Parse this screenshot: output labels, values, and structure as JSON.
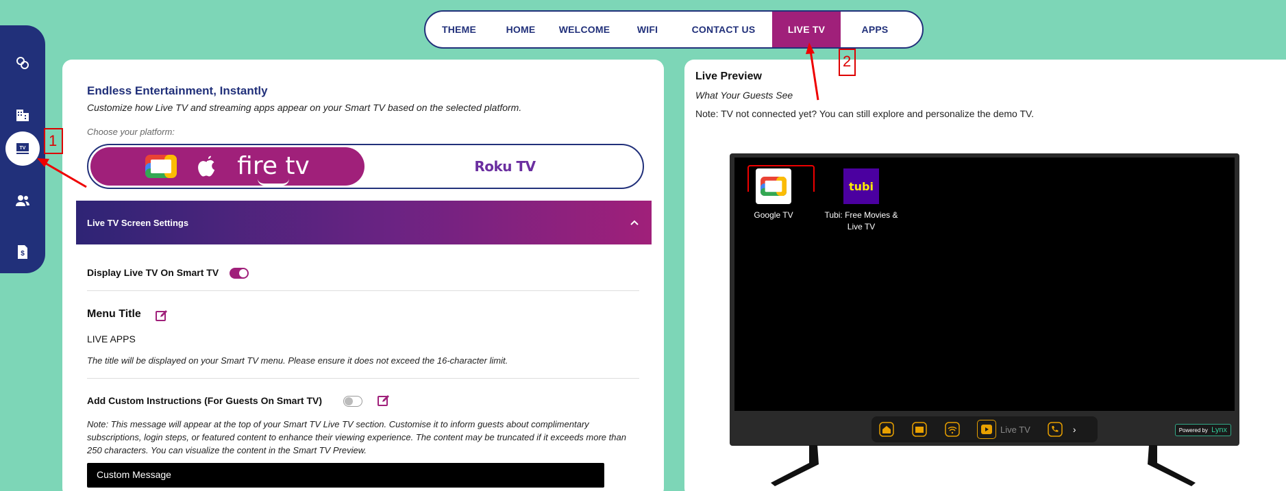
{
  "sidebar": {
    "items": [
      {
        "icon": "link-circles-icon"
      },
      {
        "icon": "building-icon"
      },
      {
        "icon": "tv-icon",
        "active": true
      },
      {
        "icon": "users-icon"
      },
      {
        "icon": "invoice-icon"
      }
    ]
  },
  "topnav": {
    "tabs": [
      {
        "label": "THEME"
      },
      {
        "label": "HOME"
      },
      {
        "label": "WELCOME"
      },
      {
        "label": "WIFI"
      },
      {
        "label": "CONTACT US"
      },
      {
        "label": "LIVE TV",
        "active": true
      },
      {
        "label": "APPS"
      }
    ]
  },
  "left": {
    "heading": "Endless Entertainment, Instantly",
    "subheading": "Customize how Live TV and streaming apps appear on your Smart TV based on the selected platform.",
    "choose_label": "Choose your platform:",
    "platform_left_text": "fire tv",
    "platform_right_text": "Roku TV",
    "section_title": "Live TV Screen Settings",
    "display_label": "Display Live TV On Smart TV",
    "display_toggle": true,
    "menu_title_label": "Menu Title",
    "menu_title_value": "LIVE APPS",
    "menu_title_note": "The title will be displayed on your Smart TV menu. Please ensure it does not exceed the 16-character limit.",
    "custom_instructions_label": "Add Custom Instructions (For Guests On Smart TV)",
    "custom_instructions_toggle": false,
    "custom_note": "Note: This message will appear at the top of your Smart TV Live TV section. Customise it to inform guests about complimentary subscriptions, login steps, or featured content to enhance their viewing experience. The content may be truncated if it exceeds more than 250 characters. You can visualize the content in the Smart TV Preview.",
    "custom_message_value": "Custom Message"
  },
  "right": {
    "title": "Live Preview",
    "subtitle": "What Your Guests See",
    "note": "Note: TV not connected yet? You can still explore and personalize the demo TV.",
    "apps": [
      {
        "name": "Google TV"
      },
      {
        "name": "Tubi: Free Movies & Live TV"
      }
    ],
    "tubi_logo": "tubi",
    "dock_live_label": "Live TV",
    "powered_by": "Powered by",
    "brand": "Lynx"
  },
  "annotations": {
    "one": "1",
    "two": "2"
  },
  "colors": {
    "background": "#7dd6b7",
    "navy": "#21307a",
    "magenta": "#a0207a",
    "annotation_red": "#dd0000"
  }
}
